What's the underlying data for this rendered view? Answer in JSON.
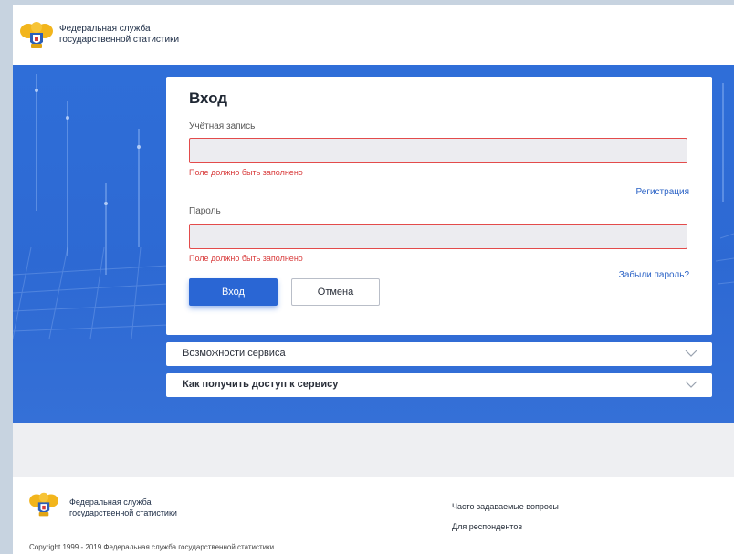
{
  "header": {
    "brand_line1": "Федеральная служба",
    "brand_line2": "государственной статистики"
  },
  "login": {
    "title": "Вход",
    "account_label": "Учётная запись",
    "account_value": "",
    "account_error": "Поле должно быть заполнено",
    "register_link": "Регистрация",
    "password_label": "Пароль",
    "password_value": "",
    "password_error": "Поле должно быть заполнено",
    "forgot_link": "Забыли пароль?",
    "submit_label": "Вход",
    "cancel_label": "Отмена"
  },
  "accordion": [
    {
      "label": "Возможности сервиса",
      "icon": "chevron-down-icon"
    },
    {
      "label": "Как получить доступ к сервису",
      "icon": "chevron-down-icon"
    }
  ],
  "footer": {
    "brand_line1": "Федеральная служба",
    "brand_line2": "государственной статистики",
    "faq_link": "Часто задаваемые вопросы",
    "respondents_link": "Для респондентов",
    "copyright": "Copyright 1999 - 2019 Федеральная служба государственной статистики"
  },
  "colors": {
    "primary": "#2a66d4",
    "hero_background": "#2f6ed8",
    "error": "#d83a3a",
    "link": "#2a62c6",
    "logo_gold": "#f2b51c"
  }
}
